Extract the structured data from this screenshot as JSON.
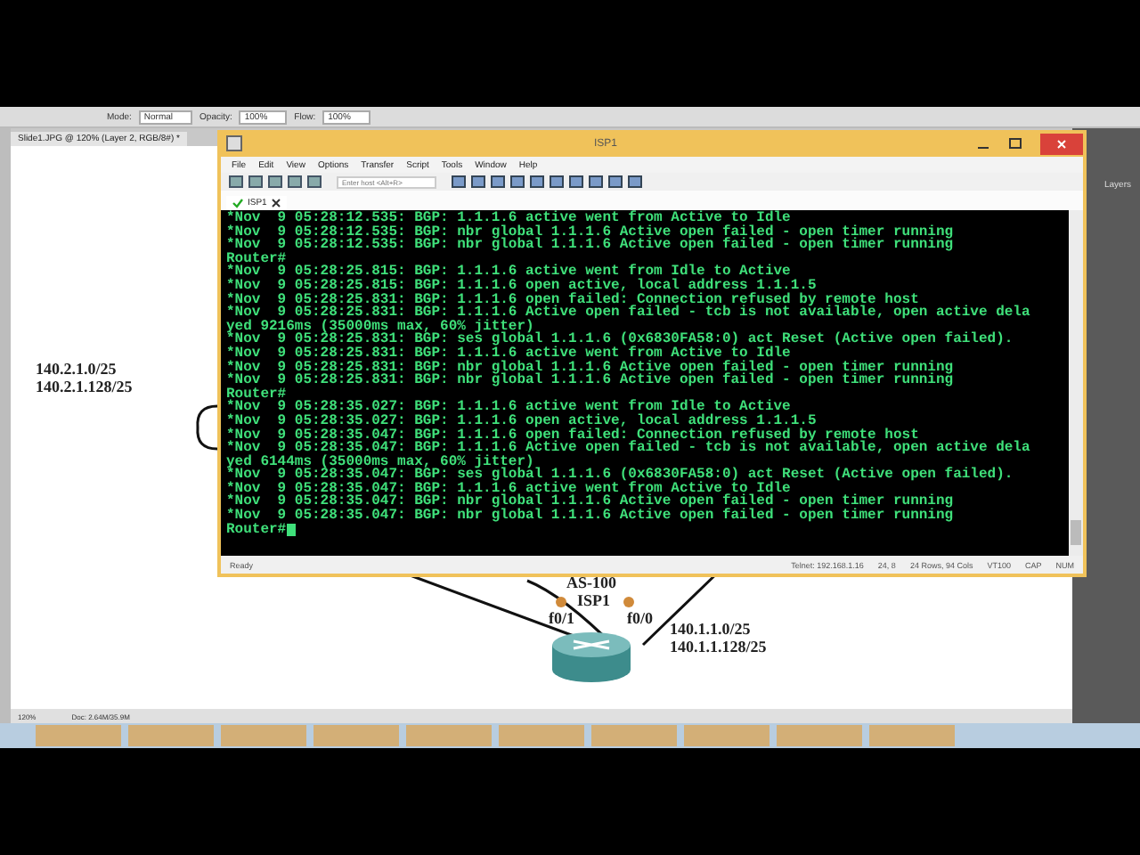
{
  "photo_editor": {
    "options_bar": [
      {
        "label": "Mode:",
        "value": "Normal"
      },
      {
        "label": "Opacity:",
        "value": "100%"
      },
      {
        "label": "Flow:",
        "value": "100%"
      }
    ],
    "document_tab": "Slide1.JPG @ 120% (Layer 2, RGB/8#) *",
    "panel_tab": "Layers",
    "canvas_labels": [
      "140.2.1.0/25",
      "140.2.1.128/25",
      "AS-100",
      "ISP1",
      "f0/1",
      "f0/0",
      "140.1.1.0/25",
      "140.1.1.128/25"
    ],
    "status_bar": {
      "zoom": "120%",
      "doc": "Doc: 2.64M/35.9M"
    }
  },
  "terminal": {
    "title": "ISP1",
    "menu": [
      "File",
      "Edit",
      "View",
      "Options",
      "Transfer",
      "Script",
      "Tools",
      "Window",
      "Help"
    ],
    "host_field": {
      "placeholder": "Enter host <Alt+R>"
    },
    "tabs": [
      {
        "label": "ISP1",
        "selected": true
      }
    ],
    "lines": [
      "*Nov  9 05:28:12.535: BGP: 1.1.1.6 active went from Active to Idle",
      "*Nov  9 05:28:12.535: BGP: nbr global 1.1.1.6 Active open failed - open timer running",
      "*Nov  9 05:28:12.535: BGP: nbr global 1.1.1.6 Active open failed - open timer running",
      "Router#",
      "*Nov  9 05:28:25.815: BGP: 1.1.1.6 active went from Idle to Active",
      "*Nov  9 05:28:25.815: BGP: 1.1.1.6 open active, local address 1.1.1.5",
      "*Nov  9 05:28:25.831: BGP: 1.1.1.6 open failed: Connection refused by remote host",
      "*Nov  9 05:28:25.831: BGP: 1.1.1.6 Active open failed - tcb is not available, open active dela",
      "yed 9216ms (35000ms max, 60% jitter)",
      "*Nov  9 05:28:25.831: BGP: ses global 1.1.1.6 (0x6830FA58:0) act Reset (Active open failed).",
      "*Nov  9 05:28:25.831: BGP: 1.1.1.6 active went from Active to Idle",
      "*Nov  9 05:28:25.831: BGP: nbr global 1.1.1.6 Active open failed - open timer running",
      "*Nov  9 05:28:25.831: BGP: nbr global 1.1.1.6 Active open failed - open timer running",
      "Router#",
      "*Nov  9 05:28:35.027: BGP: 1.1.1.6 active went from Idle to Active",
      "*Nov  9 05:28:35.027: BGP: 1.1.1.6 open active, local address 1.1.1.5",
      "*Nov  9 05:28:35.047: BGP: 1.1.1.6 open failed: Connection refused by remote host",
      "*Nov  9 05:28:35.047: BGP: 1.1.1.6 Active open failed - tcb is not available, open active dela",
      "yed 6144ms (35000ms max, 60% jitter)",
      "*Nov  9 05:28:35.047: BGP: ses global 1.1.1.6 (0x6830FA58:0) act Reset (Active open failed).",
      "*Nov  9 05:28:35.047: BGP: 1.1.1.6 active went from Active to Idle",
      "*Nov  9 05:28:35.047: BGP: nbr global 1.1.1.6 Active open failed - open timer running",
      "*Nov  9 05:28:35.047: BGP: nbr global 1.1.1.6 Active open failed - open timer running",
      "Router#"
    ],
    "status_bar": [
      "Ready",
      "Telnet: 192.168.1.16",
      "24,  8",
      "24 Rows, 94 Cols",
      "VT100",
      "CAP",
      "NUM"
    ]
  }
}
